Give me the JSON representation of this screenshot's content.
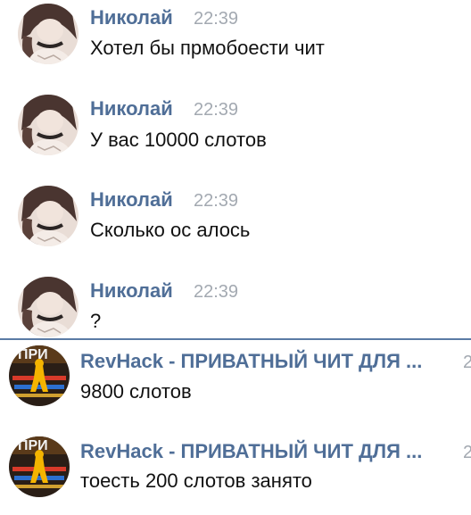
{
  "messages": [
    {
      "author": "Николай",
      "time": "22:39",
      "text": "Хотел бы прмобоести чит",
      "avatar_icon": "user-photo-avatar-icon"
    },
    {
      "author": "Николай",
      "time": "22:39",
      "text": "У вас 10000 слотов",
      "avatar_icon": "user-photo-avatar-icon"
    },
    {
      "author": "Николай",
      "time": "22:39",
      "text": "Сколько ос алось",
      "avatar_icon": "user-photo-avatar-icon"
    },
    {
      "author": "Николай",
      "time": "22:39",
      "text": "?",
      "avatar_icon": "user-photo-avatar-icon"
    },
    {
      "author": "RevHack - ПРИВАТНЫЙ ЧИТ ДЛЯ ...",
      "time_fragment": "2",
      "text": "9800 слотов",
      "avatar_icon": "community-logo-avatar-icon",
      "avatar_caption": "ПРИ"
    },
    {
      "author": "RevHack - ПРИВАТНЫЙ ЧИТ ДЛЯ ...",
      "time_fragment": "2",
      "text": "тоесть 200 слотов занято",
      "avatar_icon": "community-logo-avatar-icon",
      "avatar_caption": "ПРИ"
    }
  ],
  "colors": {
    "author_name": "#4f6e97",
    "timestamp": "#a3a9b1",
    "message_text": "#111111",
    "unread_divider": "#5b7ba5",
    "background": "#ffffff"
  }
}
